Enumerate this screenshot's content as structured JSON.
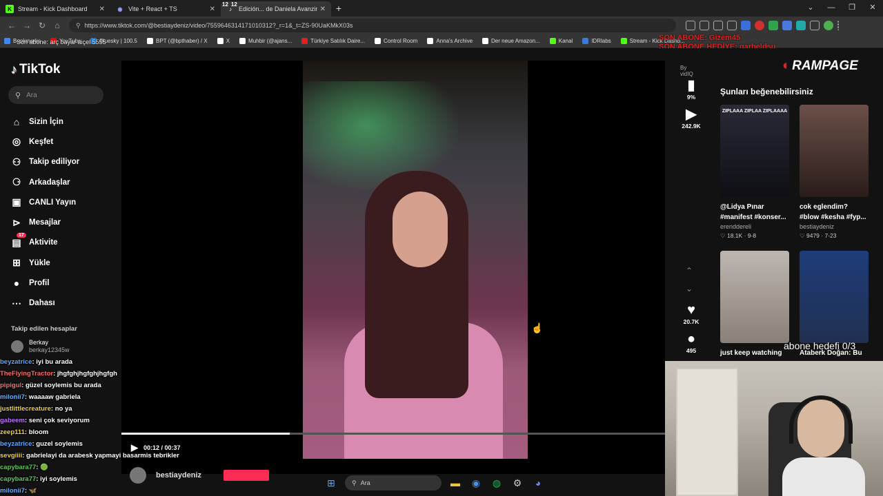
{
  "tabs": [
    {
      "label": "Stream - Kick Dashboard",
      "color": "#53fc18",
      "glyph": "K"
    },
    {
      "label": "Vite + React + TS",
      "color": "#646cff",
      "glyph": "◉"
    },
    {
      "label": "Edición... de Daniela Avanzini: K",
      "color": "#fe2c55",
      "glyph": "♪"
    }
  ],
  "tab_stickers": [
    "12",
    "12"
  ],
  "address": {
    "url": "https://www.tiktok.com/@bestiaydeniz/video/7559646314171010312?_r=1&_t=ZS-90UaKMkX03s"
  },
  "bookmarks": [
    {
      "label": "Bookmarks",
      "color": "#4285f4"
    },
    {
      "label": "YouTube",
      "color": "#ff0000"
    },
    {
      "label": "Bluesky | 100.5",
      "color": "#1185fe"
    },
    {
      "label": "BPT (@bpthaber) / X",
      "color": "#ffffff"
    },
    {
      "label": "X",
      "color": "#ffffff"
    },
    {
      "label": "Muhbir (@ajans...",
      "color": "#ffffff"
    },
    {
      "label": "Türkiye Satılık Daire...",
      "color": "#e02020"
    },
    {
      "label": "Control Room",
      "color": "#ffffff"
    },
    {
      "label": "Anna's Archive",
      "color": "#ffffff"
    },
    {
      "label": "Der neue Amazon...",
      "color": "#ffffff"
    },
    {
      "label": "Kanal",
      "color": "#53fc18"
    },
    {
      "label": "IDRlabs",
      "color": "#3a7bd5"
    },
    {
      "label": "Stream - Kick Dashb...",
      "color": "#53fc18"
    }
  ],
  "overlay_sub_text": "Son abone: arç bayar aiçel 5555",
  "abone_overlay": [
    "SON ABONE: Gizem45",
    "SON ABONE HEDİYE: garheldsu"
  ],
  "tiktok": {
    "brand": "TikTok",
    "search_placeholder": "Ara",
    "nav": [
      {
        "label": "Sizin İçin",
        "icon": "home-icon",
        "glyph": "⌂"
      },
      {
        "label": "Keşfet",
        "icon": "compass-icon",
        "glyph": "◎"
      },
      {
        "label": "Takip ediliyor",
        "icon": "following-icon",
        "glyph": "⚇"
      },
      {
        "label": "Arkadaşlar",
        "icon": "friends-icon",
        "glyph": "⚆"
      },
      {
        "label": "CANLI Yayın",
        "icon": "live-icon",
        "glyph": "▣"
      },
      {
        "label": "Mesajlar",
        "icon": "messages-icon",
        "glyph": "⊳"
      },
      {
        "label": "Aktivite",
        "icon": "activity-icon",
        "glyph": "▤",
        "badge": "17"
      },
      {
        "label": "Yükle",
        "icon": "upload-icon",
        "glyph": "⊞"
      },
      {
        "label": "Profil",
        "icon": "profile-icon",
        "glyph": "●"
      },
      {
        "label": "Dahası",
        "icon": "more-icon",
        "glyph": "⋯"
      }
    ],
    "followed_title": "Takip edilen hesaplar",
    "followed_accounts": [
      {
        "name": "Berkay",
        "handle": "berkay12345w"
      }
    ],
    "video": {
      "by": "By vidIQ",
      "vidiq_percent": "9%",
      "views": "242.9K",
      "likes": "20.7K",
      "comments": "495",
      "progress": 0.31,
      "time": "00:12 / 00:37",
      "author": "bestiaydeniz"
    },
    "suggest_title": "Şunları beğenebilirsiniz",
    "suggestions": [
      {
        "caption": "@Lidya Pınar #manifest #konser...",
        "user": "erenddereli",
        "likes": "18.1K",
        "date": "9-8",
        "thumb_text": "ZIPLAAA ZIPLAA ZIPLAAAA",
        "c1": "#2a2a38",
        "c2": "#0e0e14"
      },
      {
        "caption": "cok eglendim? #blow #kesha #fyp...",
        "user": "bestiaydeniz",
        "likes": "9479",
        "date": "7-23",
        "thumb_text": "",
        "c1": "#6a5048",
        "c2": "#2a1c1a"
      },
      {
        "caption": "just keep watching",
        "user": "",
        "likes": "",
        "date": "",
        "thumb_text": "",
        "c1": "#bdb6b0",
        "c2": "#8a7f78"
      },
      {
        "caption": "Ataberk Doğan: Bu",
        "user": "",
        "likes": "",
        "date": "",
        "thumb_text": "",
        "c1": "#1e3c7a",
        "c2": "#203050"
      }
    ]
  },
  "stream_overlay": {
    "logo": "RAMPAGE",
    "abone_hedefi": "abone hedefi 0/3",
    "chat": [
      {
        "user": "beyzatrice",
        "msg": ": iyi bu arada",
        "color": "#5fa8ff"
      },
      {
        "user": "TheFlyingTractor",
        "msg": ": jhgfghjhgfghjhgfgh",
        "color": "#ff6a6a"
      },
      {
        "user": "pipigul",
        "msg": ": güzel soylemis bu arada",
        "color": "#ff6a6a"
      },
      {
        "user": "milonii7",
        "msg": ": waaaaw gabriela",
        "color": "#6ab0ff"
      },
      {
        "user": "justlittlecreature",
        "msg": ": no ya",
        "color": "#f0d040"
      },
      {
        "user": "gabeem",
        "msg": ": seni çok seviyorum",
        "color": "#c070ff"
      },
      {
        "user": "zeep111",
        "msg": ": bloom",
        "color": "#f0d040"
      },
      {
        "user": "beyzatrice",
        "msg": ": guzel soylemis",
        "color": "#5fa8ff"
      },
      {
        "user": "sevgiiii",
        "msg": ": gabrielayi da arabesk yapmayi basarmis tebrikler",
        "color": "#f0d040"
      },
      {
        "user": "capybara77",
        "msg": ": 🟢",
        "color": "#5fc957"
      },
      {
        "user": "capybara77",
        "msg": ": iyi soylemis",
        "color": "#5fc957"
      },
      {
        "user": "milonii7",
        "msg": ": 🦋",
        "color": "#6ab0ff"
      }
    ]
  },
  "taskbar": {
    "search": "Ara"
  }
}
